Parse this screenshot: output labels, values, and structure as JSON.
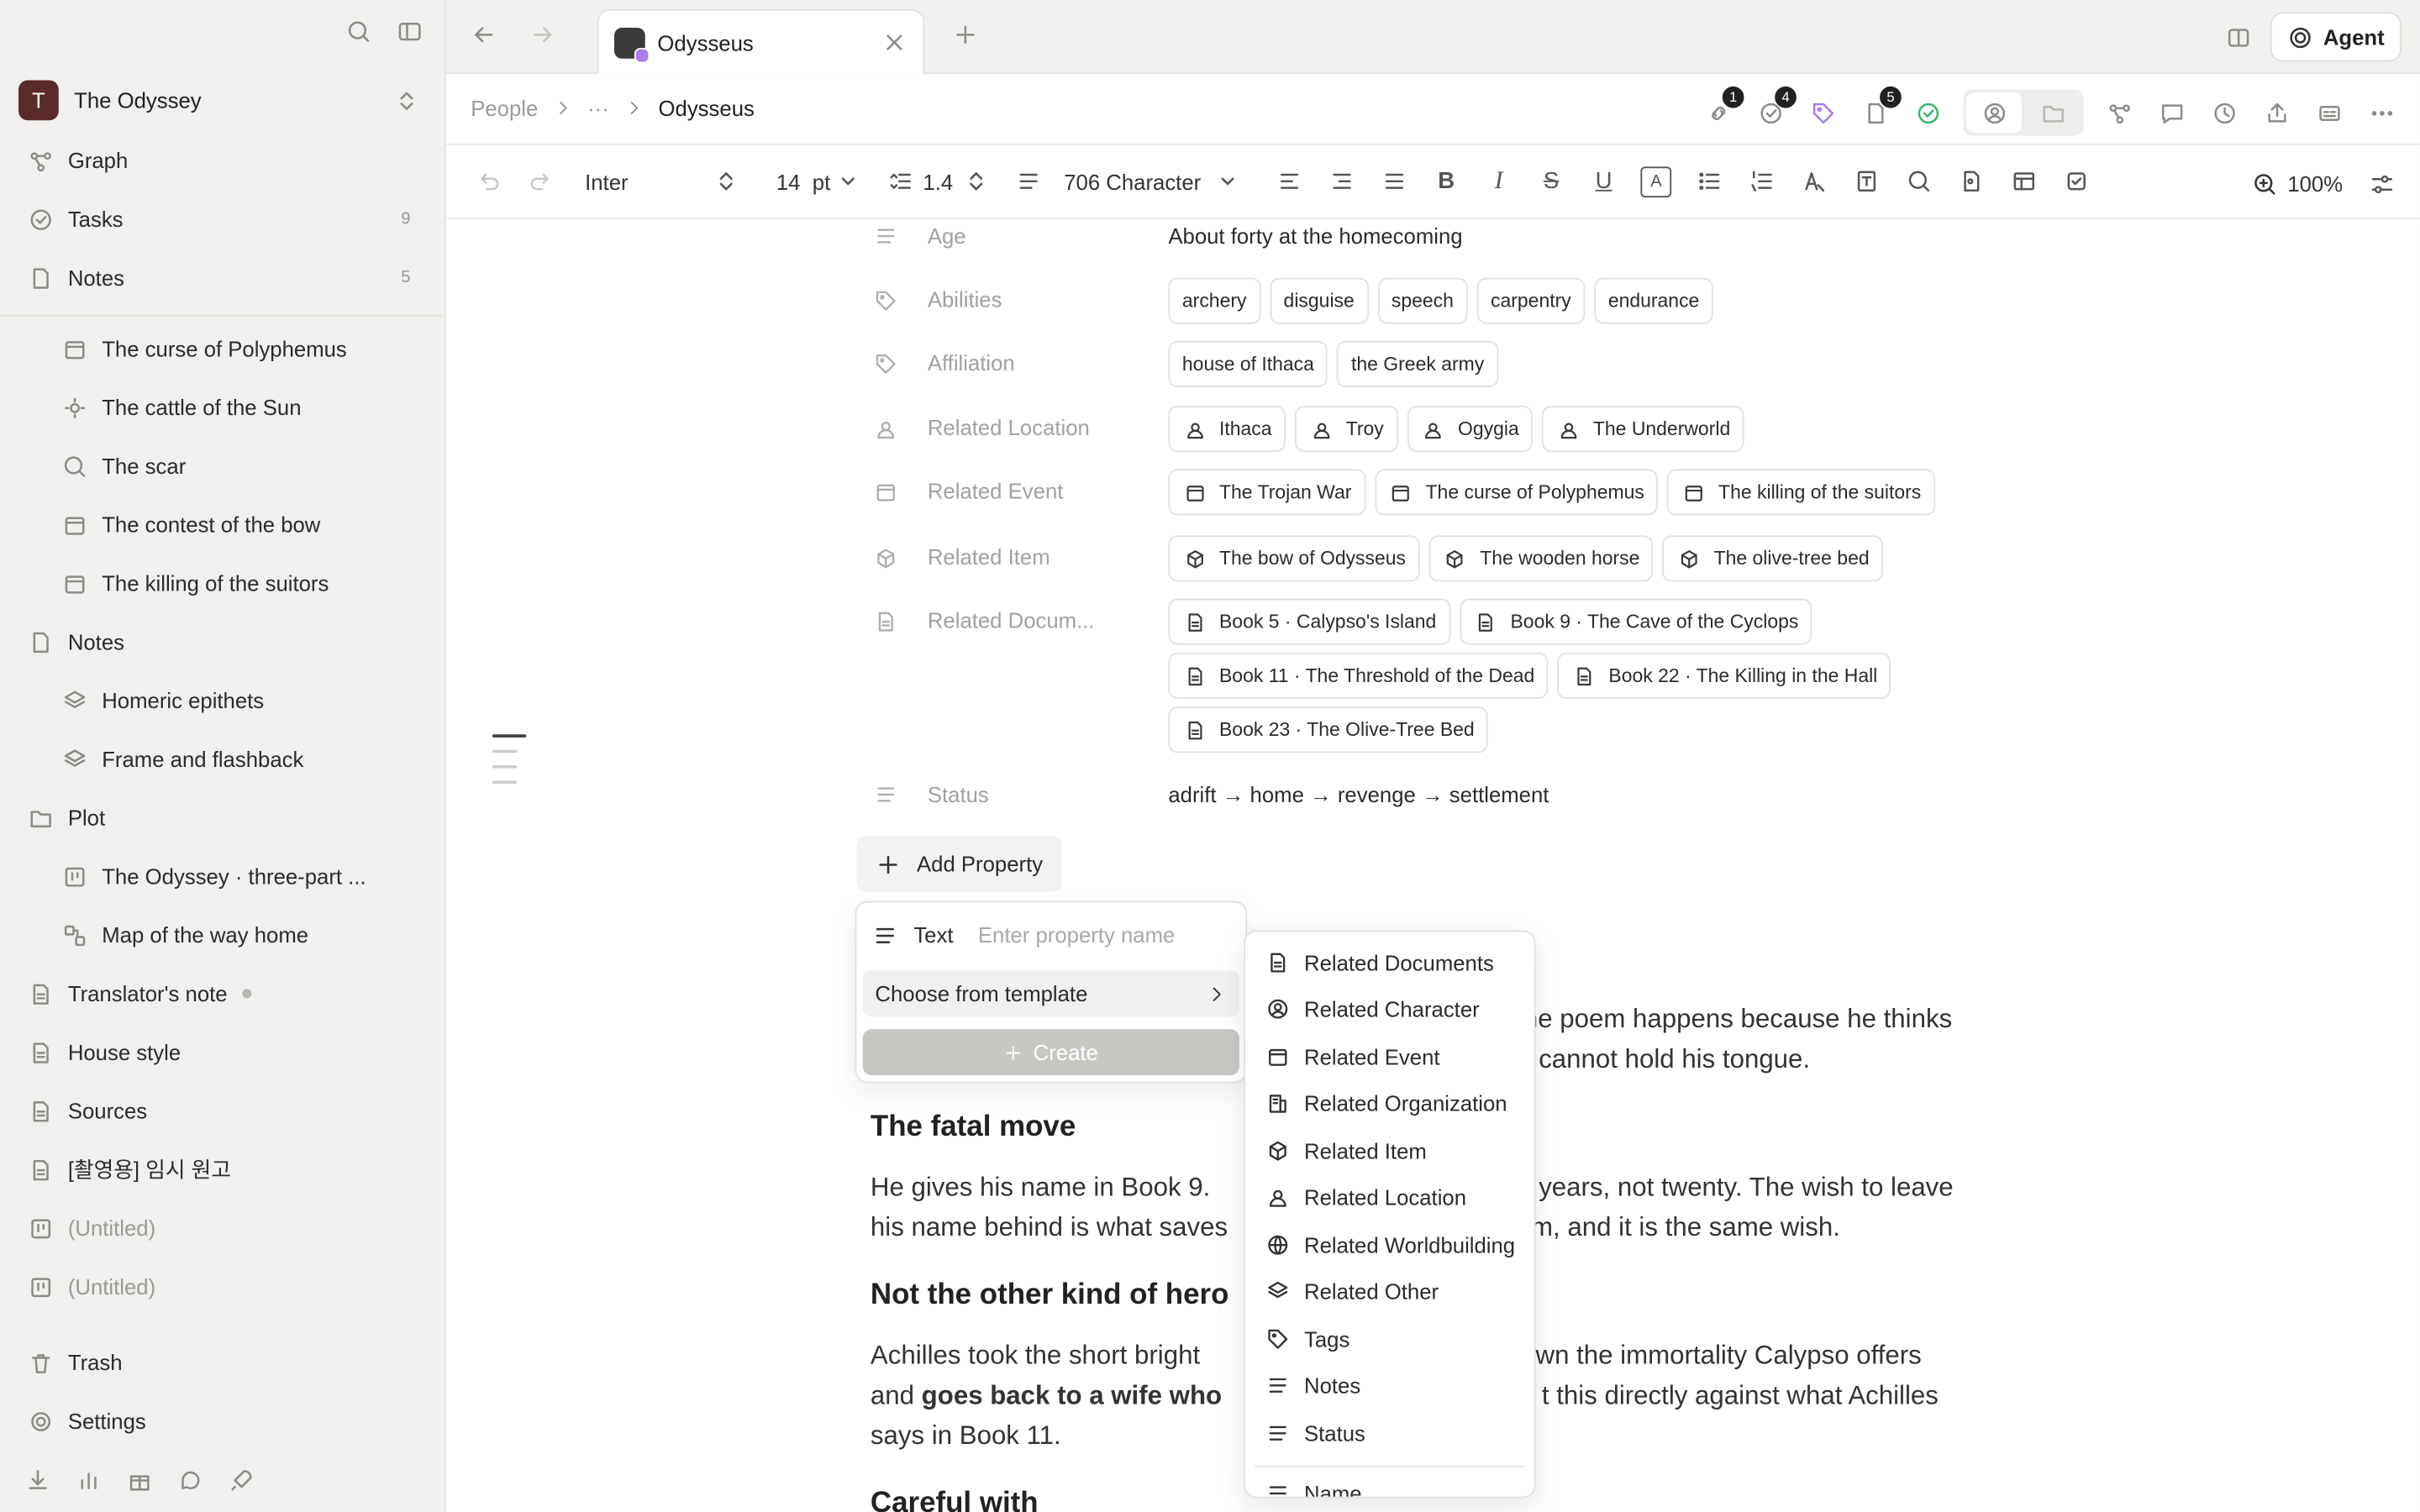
{
  "sidebar": {
    "workspace": {
      "initial": "T",
      "name": "The Odyssey"
    },
    "top": [
      {
        "label": "Graph",
        "count": ""
      },
      {
        "label": "Tasks",
        "count": "9"
      },
      {
        "label": "Notes",
        "count": "5"
      }
    ],
    "tree": [
      {
        "label": "The curse of Polyphemus"
      },
      {
        "label": "The cattle of the Sun"
      },
      {
        "label": "The scar"
      },
      {
        "label": "The contest of the bow"
      },
      {
        "label": "The killing of the suitors"
      },
      {
        "label": "Notes"
      },
      {
        "label": "Homeric epithets"
      },
      {
        "label": "Frame and flashback"
      },
      {
        "label": "Plot"
      },
      {
        "label": "The Odyssey · three-part ..."
      },
      {
        "label": "Map of the way home"
      },
      {
        "label": "Translator's note"
      },
      {
        "label": "House style"
      },
      {
        "label": "Sources"
      },
      {
        "label": "[촬영용] 임시 원고"
      },
      {
        "label": "(Untitled)"
      },
      {
        "label": "(Untitled)"
      }
    ],
    "trash": "Trash",
    "settings": "Settings"
  },
  "tabbar": {
    "tab_title": "Odysseus",
    "agent_label": "Agent"
  },
  "breadcrumb": {
    "root": "People",
    "ellipsis": "···",
    "current": "Odysseus",
    "badges": {
      "links": "1",
      "tasks": "4",
      "docs": "5"
    }
  },
  "toolbar": {
    "font": "Inter",
    "size": "14",
    "unit": "pt",
    "line_height": "1.4",
    "char_count": "706 Character",
    "zoom": "100%"
  },
  "properties": {
    "age": {
      "label": "Age",
      "value": "About forty at the homecoming"
    },
    "abilities": {
      "label": "Abilities",
      "items": [
        "archery",
        "disguise",
        "speech",
        "carpentry",
        "endurance"
      ]
    },
    "affiliation": {
      "label": "Affiliation",
      "items": [
        "house of Ithaca",
        "the Greek army"
      ]
    },
    "location": {
      "label": "Related Location",
      "items": [
        "Ithaca",
        "Troy",
        "Ogygia",
        "The Underworld"
      ]
    },
    "event": {
      "label": "Related Event",
      "items": [
        "The Trojan War",
        "The curse of Polyphemus",
        "The killing of the suitors"
      ]
    },
    "item": {
      "label": "Related Item",
      "items": [
        "The bow of Odysseus",
        "The wooden horse",
        "The olive-tree bed"
      ]
    },
    "documents": {
      "label": "Related Docum...",
      "items": [
        "Book 5 · Calypso's Island",
        "Book 9 · The Cave of the Cyclops",
        "Book 11 · The Threshold of the Dead",
        "Book 22 · The Killing in the Hall",
        "Book 23 · The Olive-Tree Bed"
      ]
    },
    "status": {
      "label": "Status",
      "value": "adrift → home → revenge → settlement"
    },
    "add_label": "Add Property"
  },
  "body": {
    "p1a": "he poem happens because he thinks",
    "p1b": "cannot hold his tongue.",
    "h_fatal": "The fatal move",
    "p2a": "He gives his name in Book 9.",
    "p2a2": "years, not twenty. The wish to leave",
    "p2b": "his name behind is what saves",
    "p2b2": "m, and it is the same wish.",
    "h_hero": "Not the other kind of hero",
    "p3a": "Achilles took the short bright",
    "p3a2": "wn the immortality Calypso offers",
    "p3b_pre": "and ",
    "p3b_bold": "goes back to a wife who",
    "p3b2": "t this directly against what Achilles",
    "p3c": "says in Book 11.",
    "h_careful": "Careful with"
  },
  "popover": {
    "type_label": "Text",
    "placeholder": "Enter property name",
    "choose": "Choose from template",
    "create": "Create"
  },
  "template_menu": {
    "items": [
      "Related Documents",
      "Related Character",
      "Related Event",
      "Related Organization",
      "Related Item",
      "Related Location",
      "Related Worldbuilding",
      "Related Other",
      "Tags",
      "Notes",
      "Status"
    ],
    "partial": "Name"
  }
}
